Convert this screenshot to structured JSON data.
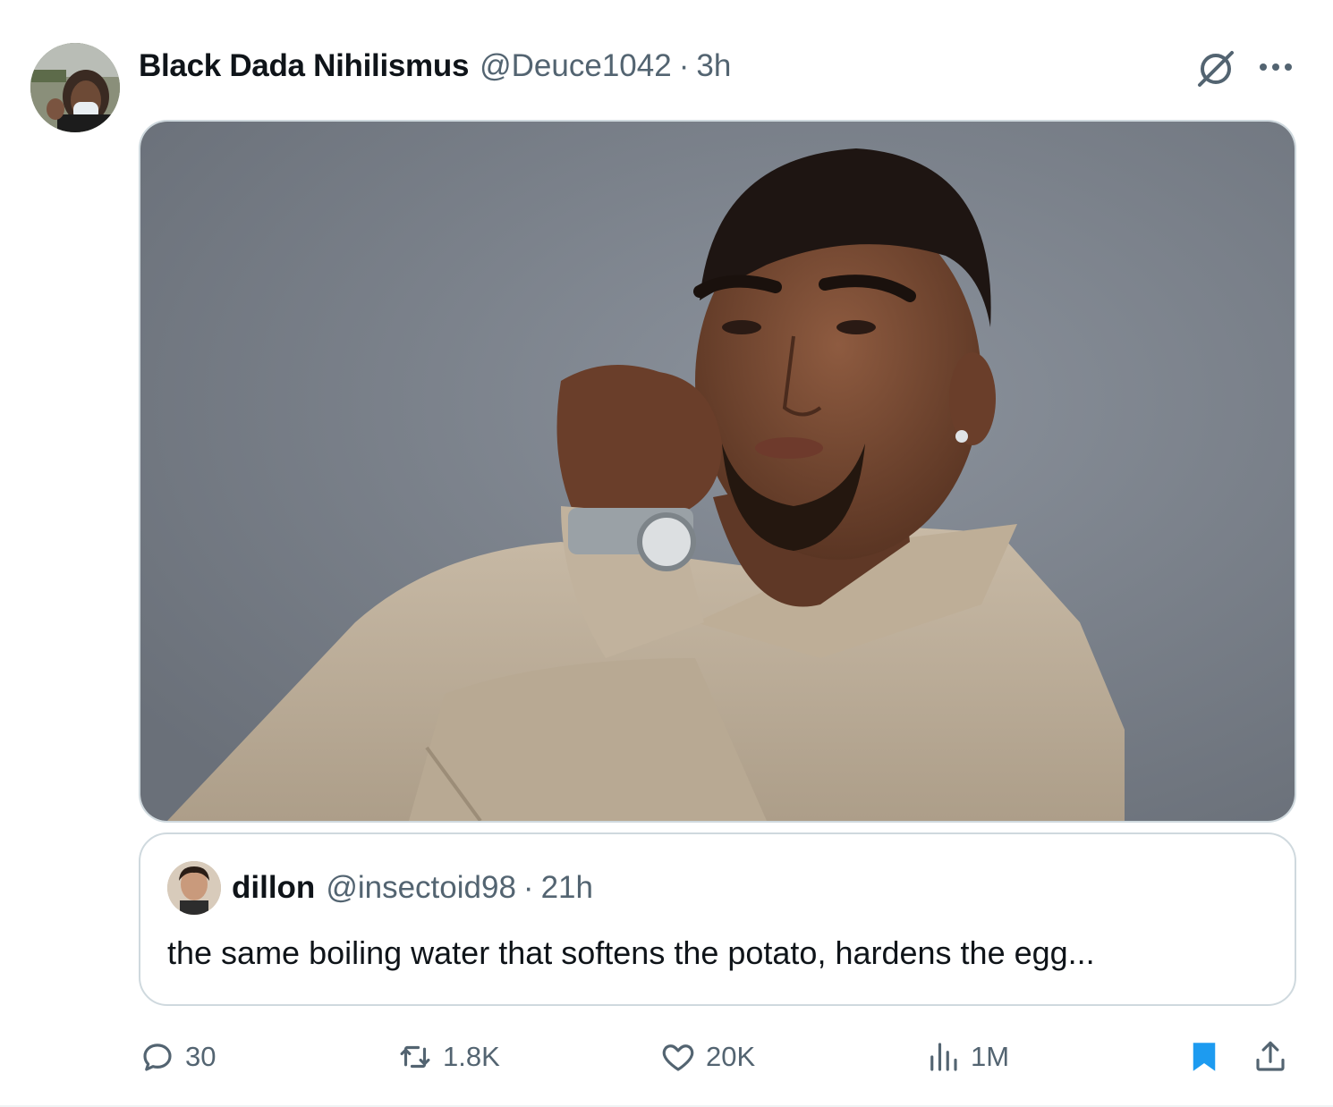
{
  "tweet": {
    "author_name": "Black Dada Nihilismus",
    "author_handle": "@Deuce1042",
    "separator": "·",
    "time": "3h"
  },
  "quote": {
    "author_name": "dillon",
    "author_handle": "@insectoid98",
    "separator": "·",
    "time": "21h",
    "text": "the same boiling water that softens the potato, hardens the egg..."
  },
  "actions": {
    "replies": "30",
    "retweets": "1.8K",
    "likes": "20K",
    "views": "1M"
  },
  "colors": {
    "text_primary": "#0f1419",
    "text_secondary": "#536471",
    "border": "#cfd9de",
    "bookmark_active": "#1d9bf0"
  },
  "icons": [
    "grok-icon",
    "more-icon",
    "reply-icon",
    "retweet-icon",
    "like-icon",
    "views-icon",
    "bookmark-icon",
    "share-icon"
  ]
}
